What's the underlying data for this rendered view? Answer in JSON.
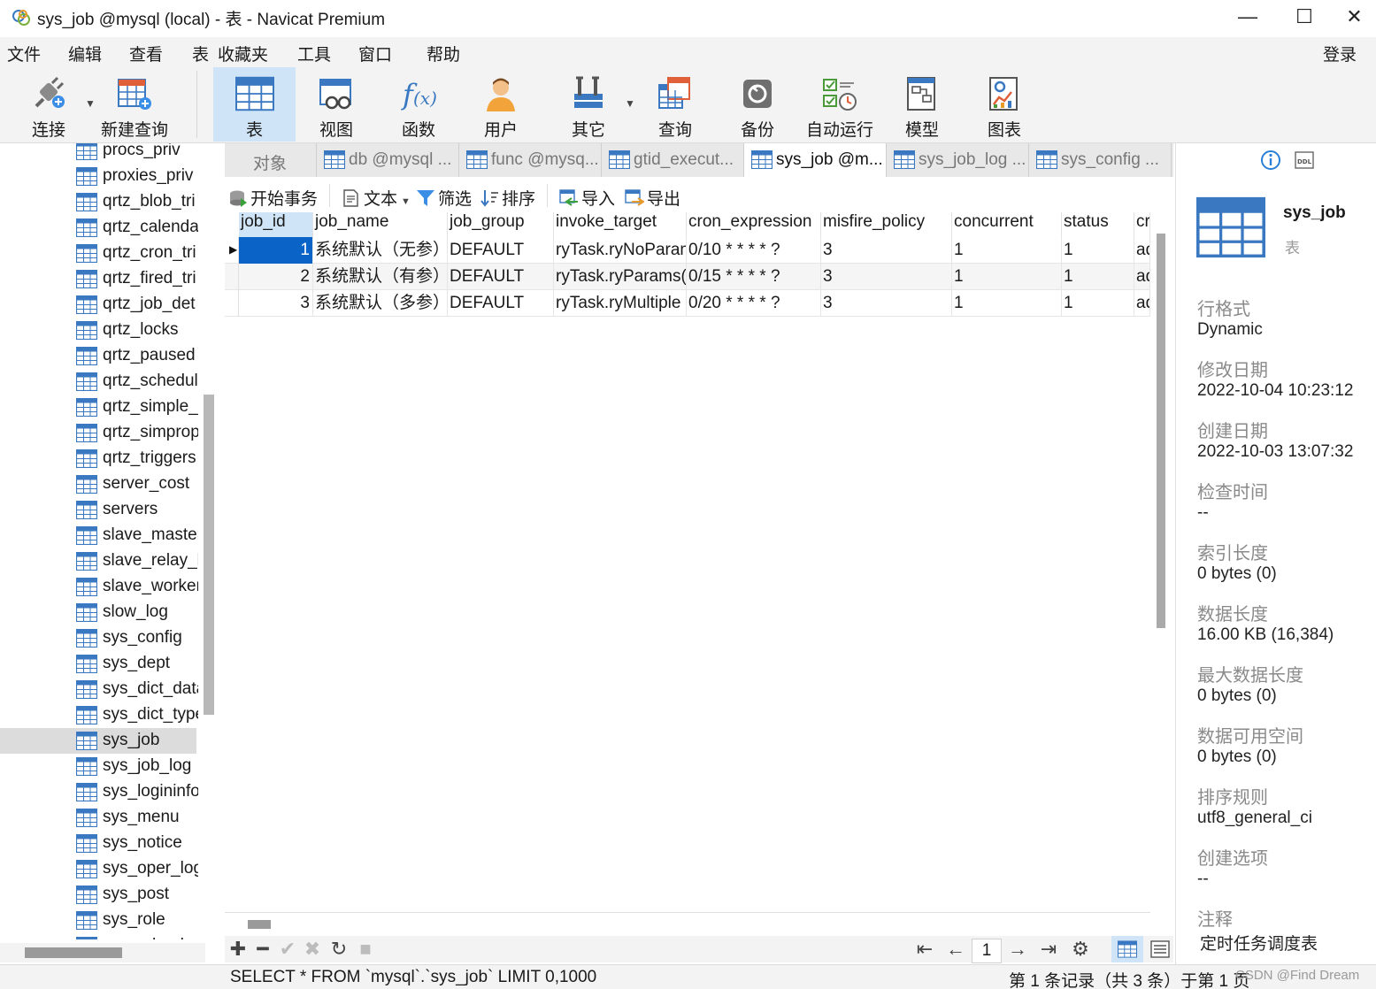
{
  "window": {
    "title": "sys_job @mysql (local) - 表 - Navicat Premium",
    "minimize": "—",
    "maximize": "☐",
    "close": "✕"
  },
  "menu": [
    "文件",
    "编辑",
    "查看",
    "表",
    "收藏夹",
    "工具",
    "窗口",
    "帮助"
  ],
  "login": "登录",
  "toolbar": [
    {
      "label": "连接",
      "icon": "plug-icon"
    },
    {
      "label": "新建查询",
      "icon": "new-query-icon"
    },
    {
      "label": "表",
      "icon": "table-icon",
      "active": true
    },
    {
      "label": "视图",
      "icon": "view-icon"
    },
    {
      "label": "函数",
      "icon": "function-icon"
    },
    {
      "label": "用户",
      "icon": "user-icon"
    },
    {
      "label": "其它",
      "icon": "tools-icon"
    },
    {
      "label": "查询",
      "icon": "query-icon"
    },
    {
      "label": "备份",
      "icon": "backup-icon"
    },
    {
      "label": "自动运行",
      "icon": "schedule-icon"
    },
    {
      "label": "模型",
      "icon": "model-icon"
    },
    {
      "label": "图表",
      "icon": "chart-icon"
    }
  ],
  "tree": {
    "items": [
      "procs_priv",
      "proxies_priv",
      "qrtz_blob_tri",
      "qrtz_calenda",
      "qrtz_cron_tri",
      "qrtz_fired_tri",
      "qrtz_job_det",
      "qrtz_locks",
      "qrtz_paused",
      "qrtz_schedul",
      "qrtz_simple_",
      "qrtz_simprop",
      "qrtz_triggers",
      "server_cost",
      "servers",
      "slave_master",
      "slave_relay_l",
      "slave_worker",
      "slow_log",
      "sys_config",
      "sys_dept",
      "sys_dict_data",
      "sys_dict_type",
      "sys_job",
      "sys_job_log",
      "sys_logininfo",
      "sys_menu",
      "sys_notice",
      "sys_oper_log",
      "sys_post",
      "sys_role",
      "sys_role_d"
    ],
    "selected": "sys_job"
  },
  "tabs": [
    {
      "label": "对象",
      "icon": false
    },
    {
      "label": "db @mysql ...",
      "icon": true
    },
    {
      "label": "func @mysq...",
      "icon": true
    },
    {
      "label": "gtid_execut...",
      "icon": true
    },
    {
      "label": "sys_job @m...",
      "icon": true,
      "active": true
    },
    {
      "label": "sys_job_log ...",
      "icon": true
    },
    {
      "label": "sys_config ...",
      "icon": true
    }
  ],
  "subtoolbar": {
    "begin_tx": "开始事务",
    "text": "文本",
    "filter": "筛选",
    "sort": "排序",
    "import": "导入",
    "export": "导出"
  },
  "grid": {
    "columns": [
      "job_id",
      "job_name",
      "job_group",
      "invoke_target",
      "cron_expression",
      "misfire_policy",
      "concurrent",
      "status",
      "cr"
    ],
    "rows": [
      [
        "1",
        "系统默认（无参）",
        "DEFAULT",
        "ryTask.ryNoParam",
        "0/10 * * * * ?",
        "3",
        "1",
        "1",
        "ad"
      ],
      [
        "2",
        "系统默认（有参）",
        "DEFAULT",
        "ryTask.ryParams('",
        "0/15 * * * * ?",
        "3",
        "1",
        "1",
        "ad"
      ],
      [
        "3",
        "系统默认（多参）",
        "DEFAULT",
        "ryTask.ryMultiple",
        "0/20 * * * * ?",
        "3",
        "1",
        "1",
        "ad"
      ]
    ]
  },
  "bottom": {
    "page": "1"
  },
  "status": {
    "sql": "SELECT * FROM `mysql`.`sys_job` LIMIT 0,1000",
    "records": "第 1 条记录（共 3 条）于第 1 页",
    "watermark": "CSDN @Find Dream"
  },
  "info_panel": {
    "name": "sys_job",
    "type": "表",
    "props": [
      {
        "label": "行格式",
        "value": "Dynamic"
      },
      {
        "label": "修改日期",
        "value": "2022-10-04 10:23:12"
      },
      {
        "label": "创建日期",
        "value": "2022-10-03 13:07:32"
      },
      {
        "label": "检查时间",
        "value": "--"
      },
      {
        "label": "索引长度",
        "value": "0 bytes (0)"
      },
      {
        "label": "数据长度",
        "value": "16.00 KB (16,384)"
      },
      {
        "label": "最大数据长度",
        "value": "0 bytes (0)"
      },
      {
        "label": "数据可用空间",
        "value": "0 bytes (0)"
      },
      {
        "label": "排序规则",
        "value": "utf8_general_ci"
      },
      {
        "label": "创建选项",
        "value": "--"
      },
      {
        "label": "注释",
        "value": "定时任务调度表"
      }
    ]
  },
  "colors": {
    "accent": "#0a64c8",
    "selection": "#cfe4f7",
    "table_icon": "#3a78c2"
  }
}
